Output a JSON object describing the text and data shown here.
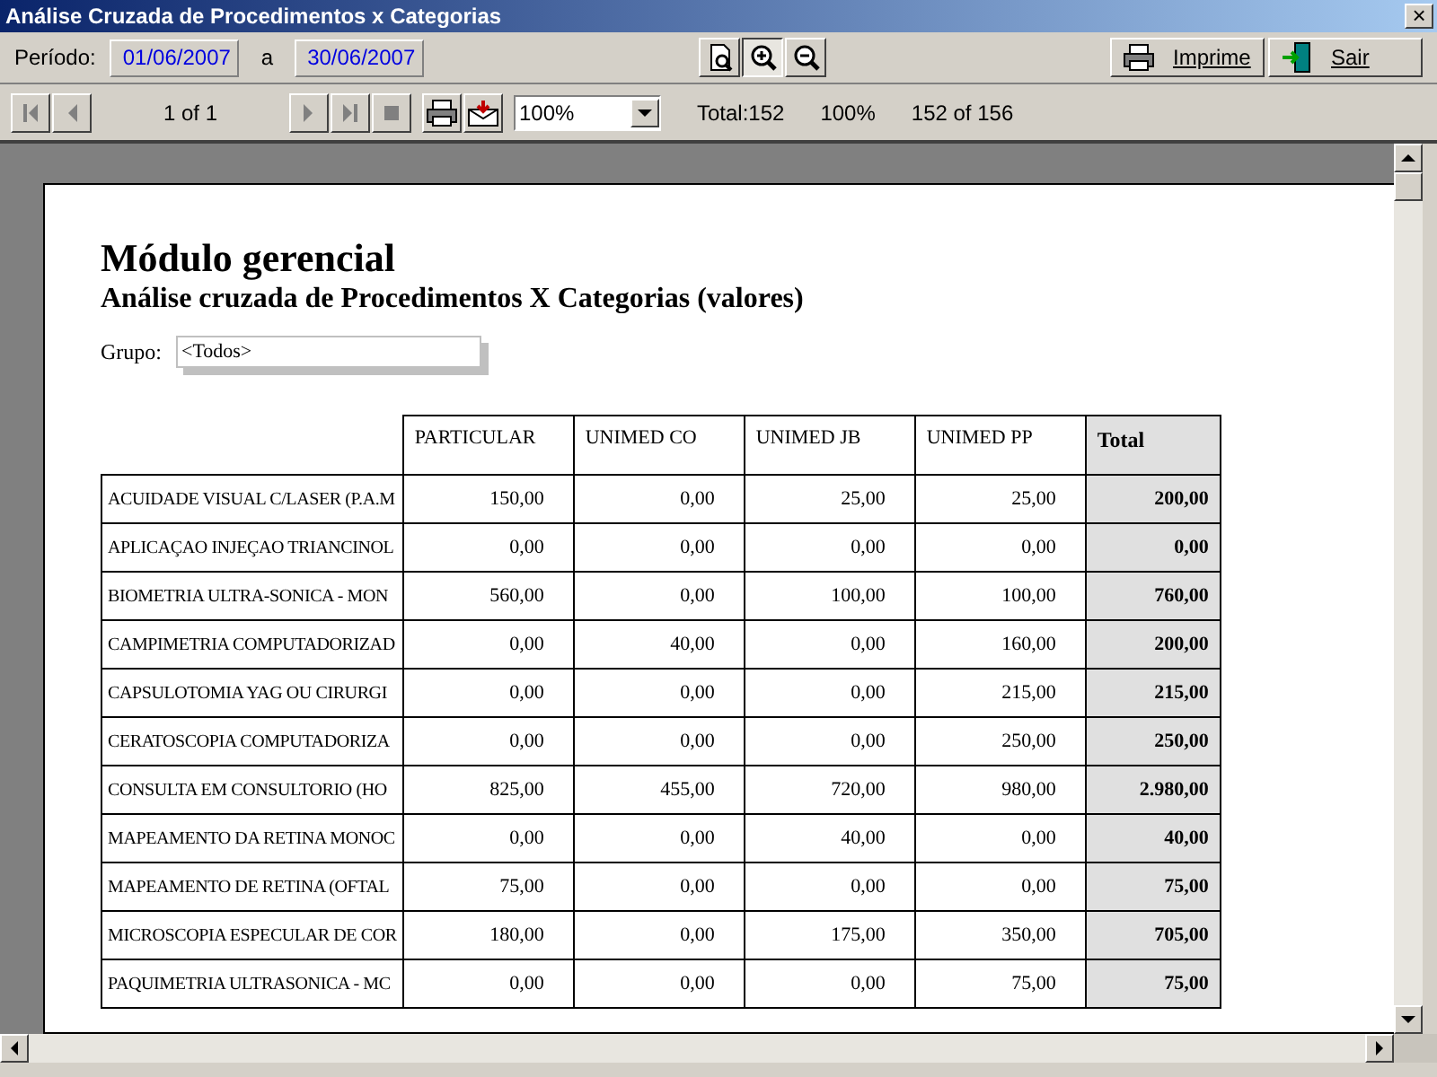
{
  "window": {
    "title": "Análise Cruzada de Procedimentos x Categorias",
    "close_label": "×"
  },
  "filter_bar": {
    "period_label": "Período:",
    "date_from": "01/06/2007",
    "separator": "a",
    "date_to": "30/06/2007",
    "view_buttons": [
      {
        "kind": "page",
        "selected": false
      },
      {
        "kind": "zoom_in",
        "selected": true
      },
      {
        "kind": "zoom_out",
        "selected": false
      }
    ],
    "actions": [
      {
        "kind": "print",
        "label": "Imprime"
      },
      {
        "kind": "exit",
        "label": "Sair"
      }
    ]
  },
  "preview_bar": {
    "nav_buttons": [
      {
        "kind": "first",
        "disabled": true
      },
      {
        "kind": "prev",
        "disabled": true
      }
    ],
    "page_info": "1 of 1",
    "nav_buttons_2": [
      {
        "kind": "next",
        "disabled": true
      },
      {
        "kind": "last",
        "disabled": true
      },
      {
        "kind": "stop",
        "disabled": true
      }
    ],
    "tool_buttons": [
      {
        "kind": "print"
      },
      {
        "kind": "export"
      }
    ],
    "zoom": "100%",
    "total": "Total:152",
    "percent": "100%",
    "progress": "152 of 156"
  },
  "report": {
    "title": "Módulo gerencial",
    "subtitle": "Análise cruzada de Procedimentos X Categorias (valores)",
    "group_label": "Grupo:",
    "group_value": "<Todos>",
    "table": {
      "columns": [
        "",
        "PARTICULAR",
        "UNIMED CO",
        "UNIMED JB",
        "UNIMED PP",
        "Total"
      ],
      "rows": [
        [
          "ACUIDADE VISUAL C/LASER (P.A.M",
          "150,00",
          "0,00",
          "25,00",
          "25,00",
          "200,00"
        ],
        [
          "APLICAÇAO INJEÇAO TRIANCINOL",
          "0,00",
          "0,00",
          "0,00",
          "0,00",
          "0,00"
        ],
        [
          "BIOMETRIA ULTRA-SONICA - MON",
          "560,00",
          "0,00",
          "100,00",
          "100,00",
          "760,00"
        ],
        [
          "CAMPIMETRIA COMPUTADORIZAD",
          "0,00",
          "40,00",
          "0,00",
          "160,00",
          "200,00"
        ],
        [
          "CAPSULOTOMIA YAG OU CIRURGI",
          "0,00",
          "0,00",
          "0,00",
          "215,00",
          "215,00"
        ],
        [
          "CERATOSCOPIA COMPUTADORIZA",
          "0,00",
          "0,00",
          "0,00",
          "250,00",
          "250,00"
        ],
        [
          "CONSULTA EM CONSULTORIO (HO",
          "825,00",
          "455,00",
          "720,00",
          "980,00",
          "2.980,00"
        ],
        [
          "MAPEAMENTO DA RETINA MONOC",
          "0,00",
          "0,00",
          "40,00",
          "0,00",
          "40,00"
        ],
        [
          "MAPEAMENTO DE RETINA (OFTAL",
          "75,00",
          "0,00",
          "0,00",
          "0,00",
          "75,00"
        ],
        [
          "MICROSCOPIA ESPECULAR DE COR",
          "180,00",
          "0,00",
          "175,00",
          "350,00",
          "705,00"
        ],
        [
          "PAQUIMETRIA ULTRASONICA - MC",
          "0,00",
          "0,00",
          "0,00",
          "75,00",
          "75,00"
        ]
      ]
    }
  }
}
